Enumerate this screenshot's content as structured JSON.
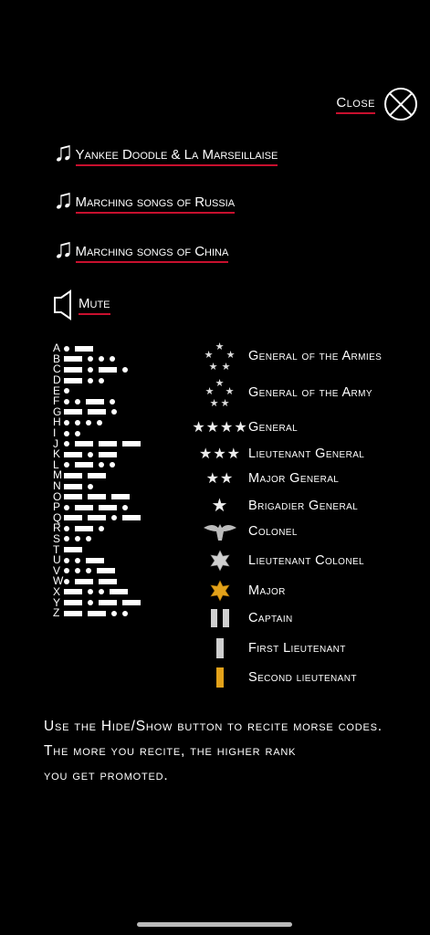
{
  "close": {
    "label": "Close"
  },
  "songs": [
    {
      "label": "Yankee Doodle & La Marseillaise"
    },
    {
      "label": "Marching songs of Russia"
    },
    {
      "label": "Marching songs of China"
    }
  ],
  "mute": {
    "label": "Mute"
  },
  "morse": [
    {
      "letter": "A",
      "code": ".-"
    },
    {
      "letter": "B",
      "code": "-..."
    },
    {
      "letter": "C",
      "code": "-.-."
    },
    {
      "letter": "D",
      "code": "-.."
    },
    {
      "letter": "E",
      "code": "."
    },
    {
      "letter": "F",
      "code": "..-."
    },
    {
      "letter": "G",
      "code": "--."
    },
    {
      "letter": "H",
      "code": "...."
    },
    {
      "letter": "I",
      "code": ".."
    },
    {
      "letter": "J",
      "code": ".---"
    },
    {
      "letter": "K",
      "code": "-.-"
    },
    {
      "letter": "L",
      "code": ".-.."
    },
    {
      "letter": "M",
      "code": "--"
    },
    {
      "letter": "N",
      "code": "-."
    },
    {
      "letter": "O",
      "code": "---"
    },
    {
      "letter": "P",
      "code": ".--."
    },
    {
      "letter": "Q",
      "code": "--.-"
    },
    {
      "letter": "R",
      "code": ".-."
    },
    {
      "letter": "S",
      "code": "..."
    },
    {
      "letter": "T",
      "code": "-"
    },
    {
      "letter": "U",
      "code": "..-"
    },
    {
      "letter": "V",
      "code": "...-"
    },
    {
      "letter": "W",
      "code": ".--"
    },
    {
      "letter": "X",
      "code": "-..-"
    },
    {
      "letter": "Y",
      "code": "-.--"
    },
    {
      "letter": "Z",
      "code": "--.."
    }
  ],
  "ranks": [
    {
      "label": "General of the Armies",
      "insignia": "five-star-circle-gold-icon"
    },
    {
      "label": "General of the Army",
      "insignia": "five-star-circle-icon"
    },
    {
      "label": "General",
      "insignia": "four-stars-icon",
      "glyph": "★★★★"
    },
    {
      "label": "Lieutenant General",
      "insignia": "three-stars-icon",
      "glyph": "★★★"
    },
    {
      "label": "Major General",
      "insignia": "two-stars-icon",
      "glyph": "★★"
    },
    {
      "label": "Brigadier General",
      "insignia": "one-star-icon",
      "glyph": "★"
    },
    {
      "label": "Colonel",
      "insignia": "eagle-icon"
    },
    {
      "label": "Lieutenant Colonel",
      "insignia": "silver-oak-leaf-icon"
    },
    {
      "label": "Major",
      "insignia": "gold-oak-leaf-icon"
    },
    {
      "label": "Captain",
      "insignia": "double-bar-icon"
    },
    {
      "label": "First Lieutenant",
      "insignia": "silver-bar-icon"
    },
    {
      "label": "Second lieutenant",
      "insignia": "gold-bar-icon"
    }
  ],
  "instructions": {
    "line1": "Use the Hide/Show button to recite morse codes.",
    "line2": "The  more you recite, the higher rank",
    "line3": "you get promoted."
  },
  "colors": {
    "accent_underline": "#c8102e",
    "background": "#000000",
    "gold": "#e3a21a",
    "silver": "#cfcfcf"
  }
}
